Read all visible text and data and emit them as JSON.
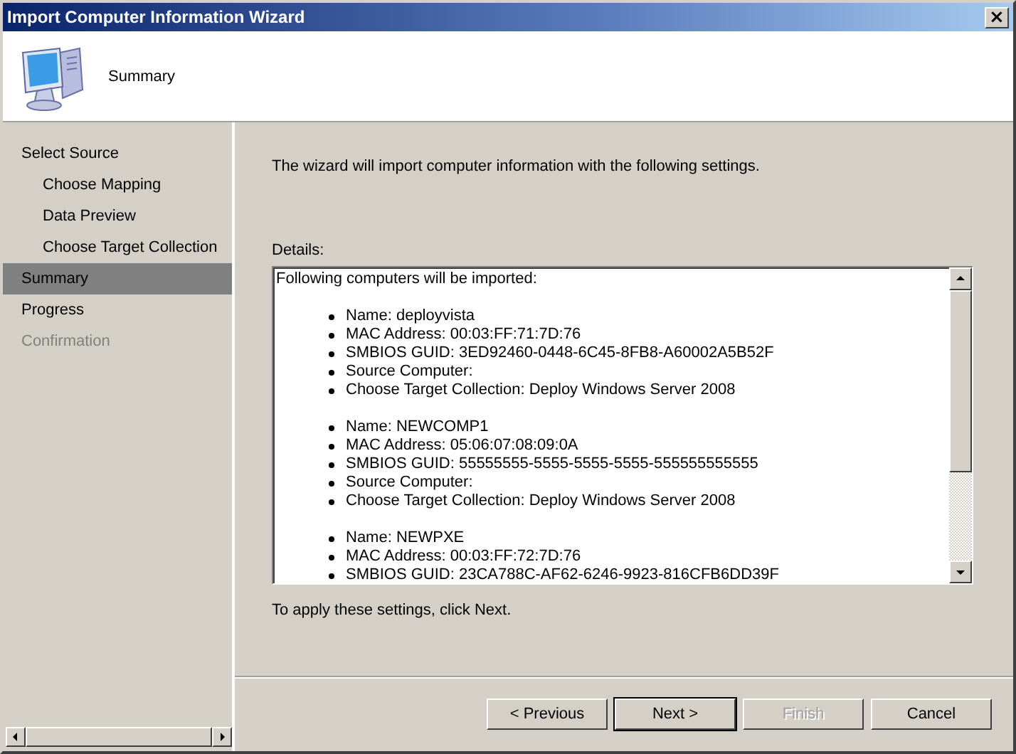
{
  "window": {
    "title": "Import Computer Information Wizard",
    "close": "×"
  },
  "header": {
    "title": "Summary"
  },
  "steps": [
    {
      "label": "Select Source",
      "selected": false,
      "disabled": false,
      "children": [
        {
          "label": "Choose Mapping",
          "selected": false,
          "disabled": false
        },
        {
          "label": "Data Preview",
          "selected": false,
          "disabled": false
        },
        {
          "label": "Choose Target Collection",
          "selected": false,
          "disabled": false
        }
      ]
    },
    {
      "label": "Summary",
      "selected": true,
      "disabled": false
    },
    {
      "label": "Progress",
      "selected": false,
      "disabled": false
    },
    {
      "label": "Confirmation",
      "selected": false,
      "disabled": true
    }
  ],
  "intro": "The wizard will import computer information with the following settings.",
  "details": {
    "label": "Details:",
    "heading": "Following computers will be imported:",
    "groups": [
      [
        "Name: deployvista",
        "MAC Address: 00:03:FF:71:7D:76",
        "SMBIOS GUID: 3ED92460-0448-6C45-8FB8-A60002A5B52F",
        "Source Computer:",
        "Choose Target Collection: Deploy Windows Server 2008"
      ],
      [
        "Name: NEWCOMP1",
        "MAC Address: 05:06:07:08:09:0A",
        "SMBIOS GUID: 55555555-5555-5555-5555-555555555555",
        "Source Computer:",
        "Choose Target Collection: Deploy Windows Server 2008"
      ],
      [
        "Name: NEWPXE",
        "MAC Address: 00:03:FF:72:7D:76",
        "SMBIOS GUID: 23CA788C-AF62-6246-9923-816CFB6DD39F"
      ]
    ]
  },
  "hint": "To apply these settings, click Next.",
  "buttons": [
    {
      "label": "< Previous",
      "disabled": false,
      "default": false
    },
    {
      "label": "Next >",
      "disabled": false,
      "default": true
    },
    {
      "label": "Finish",
      "disabled": true,
      "default": false
    },
    {
      "label": "Cancel",
      "disabled": false,
      "default": false
    }
  ]
}
